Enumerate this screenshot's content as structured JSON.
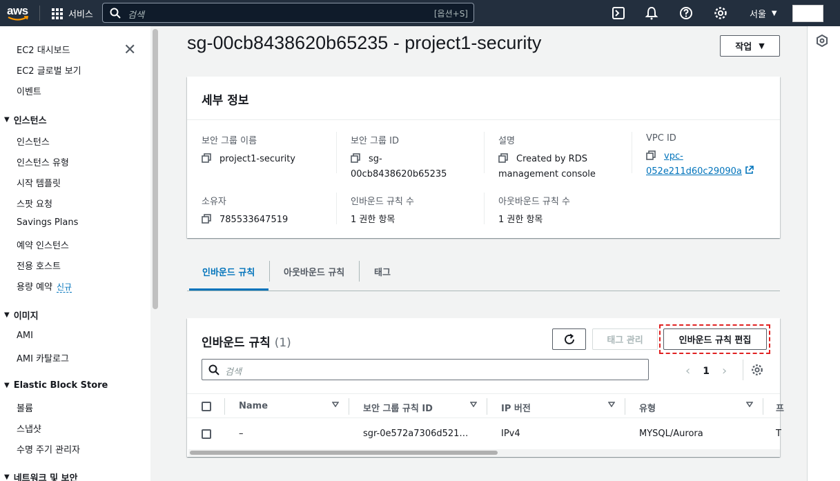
{
  "topnav": {
    "logo": "aws",
    "services": "서비스",
    "search_placeholder": "검색",
    "search_shortcut": "[옵션+S]",
    "region": "서울"
  },
  "sidebar": {
    "items": [
      {
        "label": "EC2 대시보드"
      },
      {
        "label": "EC2 글로벌 보기"
      },
      {
        "label": "이벤트"
      }
    ],
    "sections": [
      {
        "title": "인스턴스",
        "items": [
          "인스턴스",
          "인스턴스 유형",
          "시작 템플릿",
          "스팟 요청",
          "Savings Plans",
          "예약 인스턴스",
          "전용 호스트",
          "용량 예약"
        ]
      },
      {
        "title": "이미지",
        "items": [
          "AMI",
          "AMI 카탈로그"
        ]
      },
      {
        "title": "Elastic Block Store",
        "items": [
          "볼륨",
          "스냅샷",
          "수명 주기 관리자"
        ]
      },
      {
        "title": "네트워크 및 보안",
        "items": []
      }
    ],
    "new_badge": "신규"
  },
  "page": {
    "title": "sg-00cb8438620b65235 - project1-security",
    "action_button": "작업"
  },
  "details": {
    "heading": "세부 정보",
    "fields": [
      {
        "label": "보안 그룹 이름",
        "value": "project1-security"
      },
      {
        "label": "보안 그룹 ID",
        "value_line1": "sg-",
        "value_line2": "00cb8438620b65235"
      },
      {
        "label": "설명",
        "value_line1": "Created by RDS",
        "value_line2": "management console"
      },
      {
        "label": "VPC ID",
        "value_line1": "vpc-",
        "value_line2": "052e211d60c29090a"
      },
      {
        "label": "소유자",
        "value": "785533647519"
      },
      {
        "label": "인바운드 규칙 수",
        "value": "1 권한 항목"
      },
      {
        "label": "아웃바운드 규칙 수",
        "value": "1 권한 항목"
      }
    ]
  },
  "tabs": [
    "인바운드 규칙",
    "아웃바운드 규칙",
    "태그"
  ],
  "rules": {
    "heading": "인바운드 규칙",
    "count": "(1)",
    "tag_button": "태그 관리",
    "edit_button": "인바운드 규칙 편집",
    "search_placeholder": "검색",
    "page_number": "1",
    "columns": [
      "Name",
      "보안 그룹 규칙 ID",
      "IP 버전",
      "유형",
      "프"
    ],
    "row": {
      "name": "–",
      "rule_id": "sgr-0e572a7306d521…",
      "ip_version": "IPv4",
      "type": "MYSQL/Aurora",
      "extra": "T"
    }
  },
  "colors": {
    "nav_bg": "#232f3e",
    "link": "#0073bb",
    "highlight": "#e02020"
  }
}
